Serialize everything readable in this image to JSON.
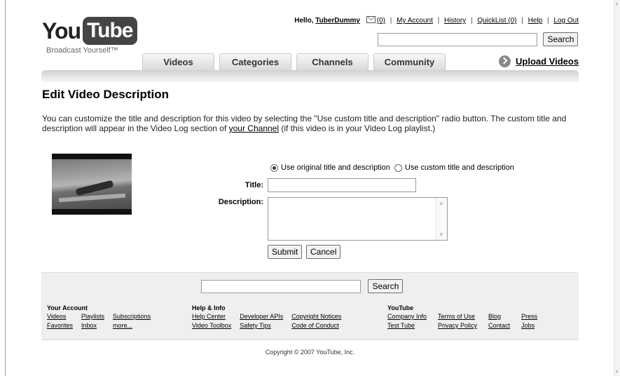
{
  "logo": {
    "you": "You",
    "tube": "Tube",
    "tagline": "Broadcast Yourself™"
  },
  "util": {
    "hello": "Hello,",
    "username": "TuberDummy",
    "inbox_count": "(0)",
    "my_account": "My Account",
    "history": "History",
    "quicklist": "QuickList",
    "quicklist_count": "(0)",
    "help": "Help",
    "logout": "Log Out"
  },
  "top_search": {
    "button": "Search"
  },
  "tabs": [
    "Videos",
    "Categories",
    "Channels",
    "Community"
  ],
  "upload_label": "Upload Videos",
  "page": {
    "title": "Edit Video Description",
    "intro_before": "You can customize the title and description for this video by selecting the \"Use custom title and description\" radio button. The custom title and description will appear in the Video Log section of ",
    "intro_link": "your Channel",
    "intro_after": " (if this video is in your Video Log playlist.)"
  },
  "form": {
    "radio_original": "Use original title and description",
    "radio_custom": "Use custom title and description",
    "selected": "original",
    "title_label": "Title:",
    "title_value": "",
    "description_label": "Description:",
    "description_value": "",
    "submit": "Submit",
    "cancel": "Cancel"
  },
  "footer": {
    "search_button": "Search",
    "your_account": {
      "heading": "Your Account",
      "links": [
        "Videos",
        "Playlists",
        "Subscriptions",
        "Favorites",
        "Inbox",
        "more..."
      ]
    },
    "help_info": {
      "heading": "Help & Info",
      "links": [
        "Help Center",
        "Developer APIs",
        "Copyright Notices",
        "Video Toolbox",
        "Safety Tips",
        "Code of Conduct"
      ]
    },
    "youtube": {
      "heading": "YouTube",
      "links": [
        "Company Info",
        "Terms of Use",
        "Blog",
        "Press",
        "Test Tube",
        "Privacy Policy",
        "Contact",
        "Jobs"
      ]
    },
    "copyright": "Copyright © 2007 YouTube, Inc."
  }
}
